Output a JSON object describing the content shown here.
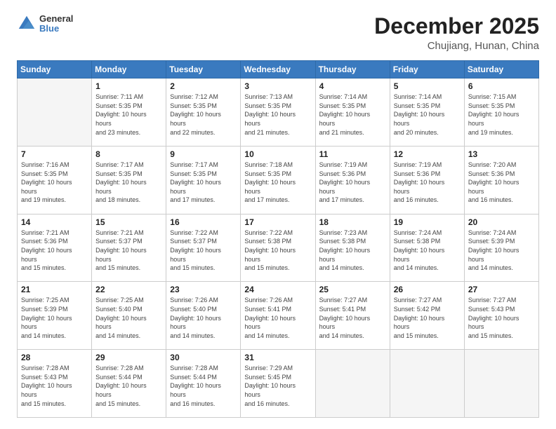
{
  "logo": {
    "general": "General",
    "blue": "Blue"
  },
  "header": {
    "month": "December 2025",
    "location": "Chujiang, Hunan, China"
  },
  "weekdays": [
    "Sunday",
    "Monday",
    "Tuesday",
    "Wednesday",
    "Thursday",
    "Friday",
    "Saturday"
  ],
  "weeks": [
    [
      {
        "day": "",
        "empty": true
      },
      {
        "day": "1",
        "sunrise": "7:11 AM",
        "sunset": "5:35 PM",
        "daylight": "10 hours and 23 minutes."
      },
      {
        "day": "2",
        "sunrise": "7:12 AM",
        "sunset": "5:35 PM",
        "daylight": "10 hours and 22 minutes."
      },
      {
        "day": "3",
        "sunrise": "7:13 AM",
        "sunset": "5:35 PM",
        "daylight": "10 hours and 21 minutes."
      },
      {
        "day": "4",
        "sunrise": "7:14 AM",
        "sunset": "5:35 PM",
        "daylight": "10 hours and 21 minutes."
      },
      {
        "day": "5",
        "sunrise": "7:14 AM",
        "sunset": "5:35 PM",
        "daylight": "10 hours and 20 minutes."
      },
      {
        "day": "6",
        "sunrise": "7:15 AM",
        "sunset": "5:35 PM",
        "daylight": "10 hours and 19 minutes."
      }
    ],
    [
      {
        "day": "7",
        "sunrise": "7:16 AM",
        "sunset": "5:35 PM",
        "daylight": "10 hours and 19 minutes."
      },
      {
        "day": "8",
        "sunrise": "7:17 AM",
        "sunset": "5:35 PM",
        "daylight": "10 hours and 18 minutes."
      },
      {
        "day": "9",
        "sunrise": "7:17 AM",
        "sunset": "5:35 PM",
        "daylight": "10 hours and 17 minutes."
      },
      {
        "day": "10",
        "sunrise": "7:18 AM",
        "sunset": "5:35 PM",
        "daylight": "10 hours and 17 minutes."
      },
      {
        "day": "11",
        "sunrise": "7:19 AM",
        "sunset": "5:36 PM",
        "daylight": "10 hours and 17 minutes."
      },
      {
        "day": "12",
        "sunrise": "7:19 AM",
        "sunset": "5:36 PM",
        "daylight": "10 hours and 16 minutes."
      },
      {
        "day": "13",
        "sunrise": "7:20 AM",
        "sunset": "5:36 PM",
        "daylight": "10 hours and 16 minutes."
      }
    ],
    [
      {
        "day": "14",
        "sunrise": "7:21 AM",
        "sunset": "5:36 PM",
        "daylight": "10 hours and 15 minutes."
      },
      {
        "day": "15",
        "sunrise": "7:21 AM",
        "sunset": "5:37 PM",
        "daylight": "10 hours and 15 minutes."
      },
      {
        "day": "16",
        "sunrise": "7:22 AM",
        "sunset": "5:37 PM",
        "daylight": "10 hours and 15 minutes."
      },
      {
        "day": "17",
        "sunrise": "7:22 AM",
        "sunset": "5:38 PM",
        "daylight": "10 hours and 15 minutes."
      },
      {
        "day": "18",
        "sunrise": "7:23 AM",
        "sunset": "5:38 PM",
        "daylight": "10 hours and 14 minutes."
      },
      {
        "day": "19",
        "sunrise": "7:24 AM",
        "sunset": "5:38 PM",
        "daylight": "10 hours and 14 minutes."
      },
      {
        "day": "20",
        "sunrise": "7:24 AM",
        "sunset": "5:39 PM",
        "daylight": "10 hours and 14 minutes."
      }
    ],
    [
      {
        "day": "21",
        "sunrise": "7:25 AM",
        "sunset": "5:39 PM",
        "daylight": "10 hours and 14 minutes."
      },
      {
        "day": "22",
        "sunrise": "7:25 AM",
        "sunset": "5:40 PM",
        "daylight": "10 hours and 14 minutes."
      },
      {
        "day": "23",
        "sunrise": "7:26 AM",
        "sunset": "5:40 PM",
        "daylight": "10 hours and 14 minutes."
      },
      {
        "day": "24",
        "sunrise": "7:26 AM",
        "sunset": "5:41 PM",
        "daylight": "10 hours and 14 minutes."
      },
      {
        "day": "25",
        "sunrise": "7:27 AM",
        "sunset": "5:41 PM",
        "daylight": "10 hours and 14 minutes."
      },
      {
        "day": "26",
        "sunrise": "7:27 AM",
        "sunset": "5:42 PM",
        "daylight": "10 hours and 15 minutes."
      },
      {
        "day": "27",
        "sunrise": "7:27 AM",
        "sunset": "5:43 PM",
        "daylight": "10 hours and 15 minutes."
      }
    ],
    [
      {
        "day": "28",
        "sunrise": "7:28 AM",
        "sunset": "5:43 PM",
        "daylight": "10 hours and 15 minutes."
      },
      {
        "day": "29",
        "sunrise": "7:28 AM",
        "sunset": "5:44 PM",
        "daylight": "10 hours and 15 minutes."
      },
      {
        "day": "30",
        "sunrise": "7:28 AM",
        "sunset": "5:44 PM",
        "daylight": "10 hours and 16 minutes."
      },
      {
        "day": "31",
        "sunrise": "7:29 AM",
        "sunset": "5:45 PM",
        "daylight": "10 hours and 16 minutes."
      },
      {
        "day": "",
        "empty": true
      },
      {
        "day": "",
        "empty": true
      },
      {
        "day": "",
        "empty": true
      }
    ]
  ]
}
